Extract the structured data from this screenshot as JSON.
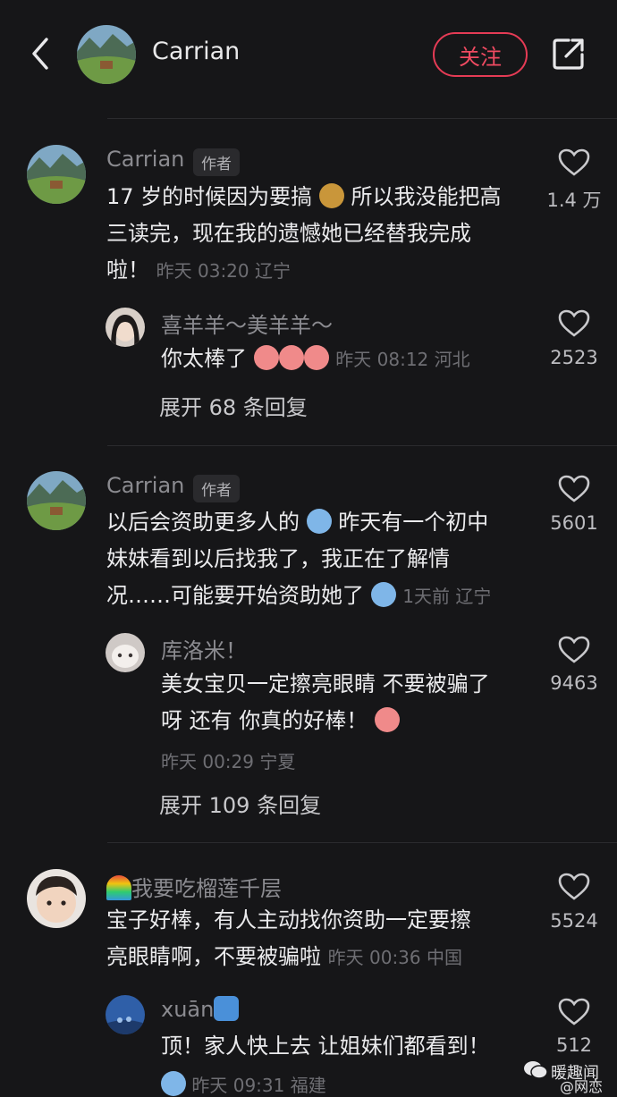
{
  "header": {
    "title": "Carrian",
    "follow_label": "关注"
  },
  "comments": [
    {
      "author": "Carrian",
      "badge": "作者",
      "lines": [
        "17 岁的时候因为要搞",
        "所以我没能把高",
        "三读完，现在我的遗憾她已经替我完成",
        "啦！"
      ],
      "meta": "昨天 03:20 辽宁",
      "likes": "1.4 万",
      "reply": {
        "author": "喜羊羊～美羊羊～",
        "text": "你太棒了",
        "meta": "昨天 08:12 河北",
        "likes": "2523"
      },
      "expand": "展开 68 条回复"
    },
    {
      "author": "Carrian",
      "badge": "作者",
      "lines": [
        "以后会资助更多人的",
        "昨天有一个初中",
        "妹妹看到以后找我了，我正在了解情",
        "况……可能要开始资助她了"
      ],
      "meta": "1天前 辽宁",
      "likes": "5601",
      "reply": {
        "author": "库洛米！",
        "lines": [
          "美女宝贝一定擦亮眼睛 不要被骗了",
          "呀 还有 你真的好棒！"
        ],
        "meta": "昨天 00:29 宁夏",
        "likes": "9463"
      },
      "expand": "展开 109 条回复"
    },
    {
      "author": "我要吃榴莲千层",
      "lines": [
        "宝子好棒，有人主动找你资助一定要擦",
        "亮眼睛啊，不要被骗啦"
      ],
      "meta": "昨天 00:36 中国",
      "likes": "5524",
      "reply": {
        "author": "xuān",
        "text": "顶！家人快上去 让姐妹们都看到！",
        "meta": "昨天 09:31 福建",
        "likes": "512"
      }
    }
  ],
  "watermark": {
    "line1": "暖趣闻",
    "line2": "@网恋"
  },
  "colors": {
    "background": "#161618",
    "follow_accent": "#e53b55"
  },
  "icons": [
    "back-arrow-icon",
    "share-icon",
    "heart-icon",
    "money-bag-emoji",
    "crying-emoji",
    "rainbow-emoji",
    "wave-emoji",
    "wechat-icon"
  ]
}
